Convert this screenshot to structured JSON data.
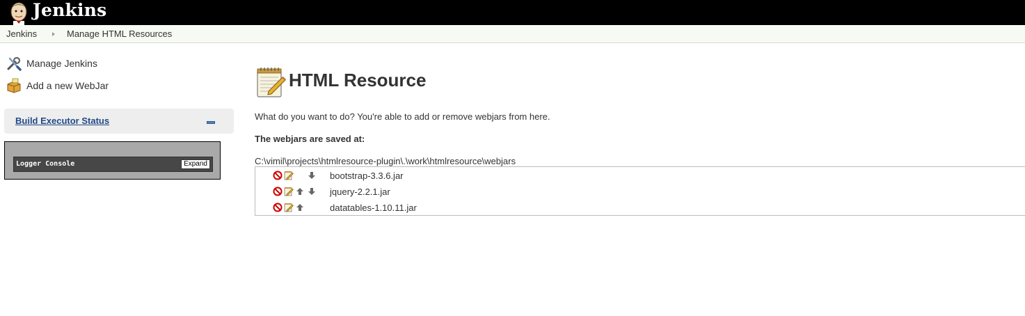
{
  "header": {
    "brand": "Jenkins"
  },
  "breadcrumbs": [
    {
      "label": "Jenkins"
    },
    {
      "label": "Manage HTML Resources"
    }
  ],
  "side_panel": {
    "tasks": [
      {
        "label": "Manage Jenkins",
        "icon": "wrench-screwdriver-icon"
      },
      {
        "label": "Add a new WebJar",
        "icon": "package-box-icon"
      }
    ],
    "executor": {
      "title": "Build Executor Status"
    },
    "logger": {
      "title": "Logger Console",
      "expand_label": "Expand"
    }
  },
  "main": {
    "title": "HTML Resource",
    "title_icon": "notepad-pencil-icon",
    "intro": "What do you want to do? You're able to add or remove webjars from here.",
    "saved_heading": "The webjars are saved at:",
    "path": "C:\\vimil\\projects\\htmlresource-plugin\\.\\work\\htmlresource\\webjars",
    "webjars": [
      {
        "name": "bootstrap-3.3.6.jar",
        "can_move_up": false,
        "can_move_down": true
      },
      {
        "name": "jquery-2.2.1.jar",
        "can_move_up": true,
        "can_move_down": true
      },
      {
        "name": "datatables-1.10.11.jar",
        "can_move_up": true,
        "can_move_down": false
      }
    ]
  },
  "colors": {
    "header_bg": "#000000",
    "breadcrumb_bg": "#f6faf2",
    "link": "#204a87",
    "delete": "#cc0000"
  }
}
